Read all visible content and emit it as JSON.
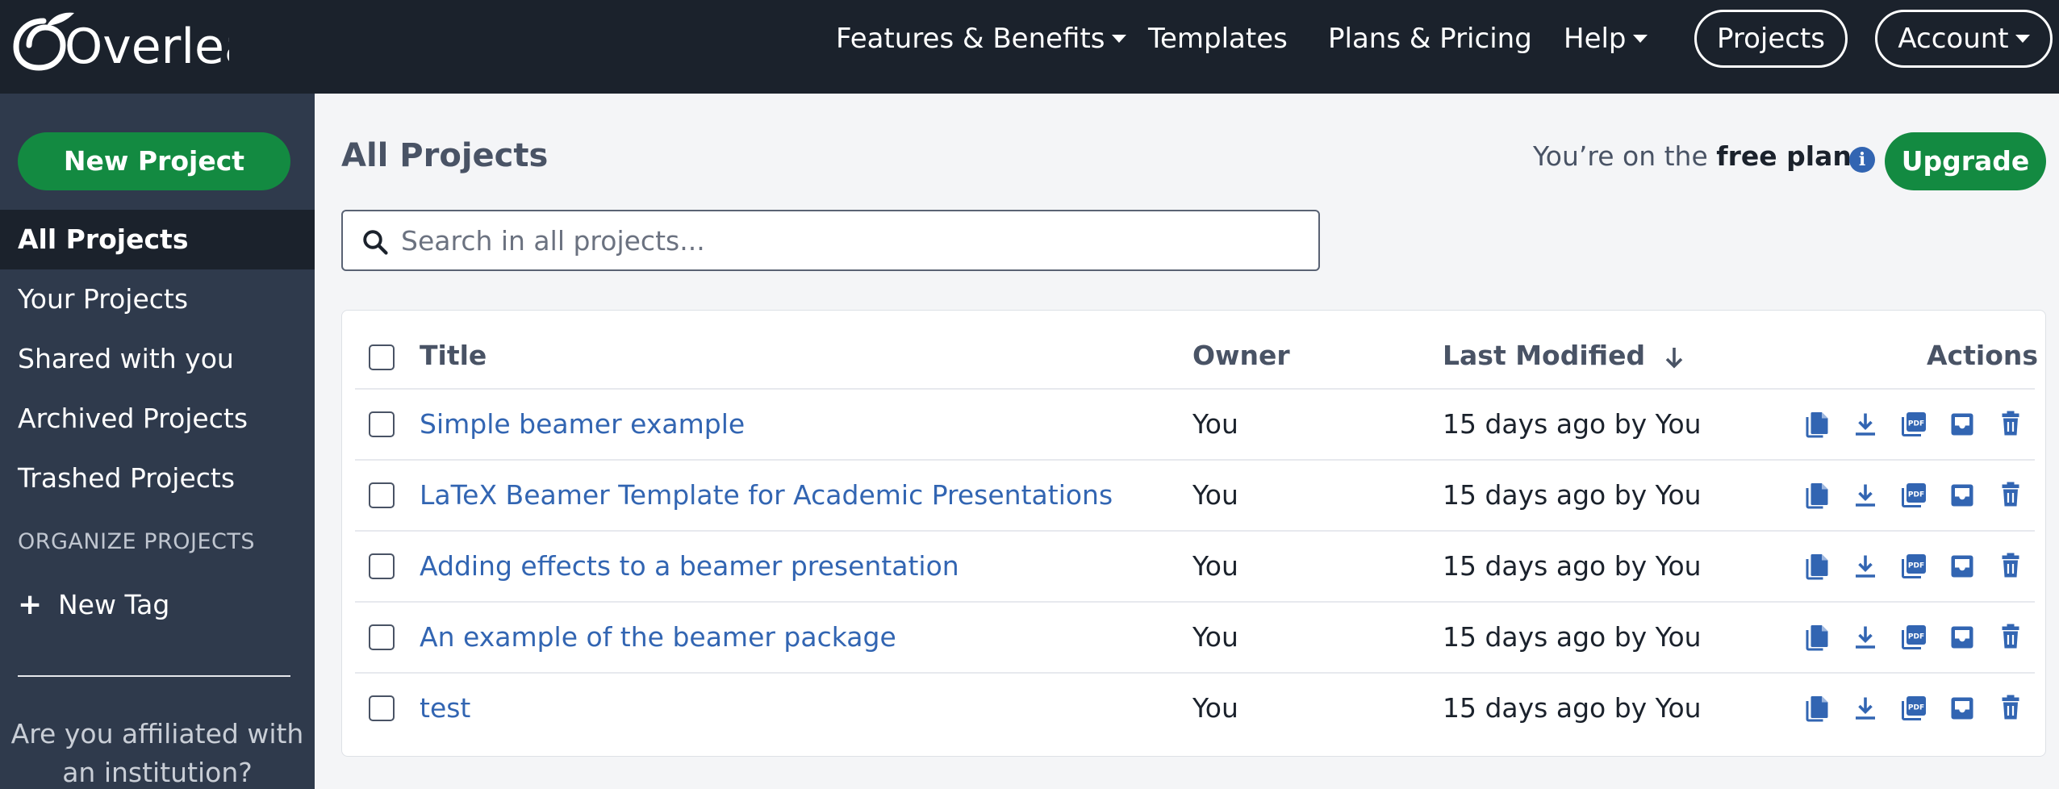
{
  "colors": {
    "nav_bg": "#1b222c",
    "sidebar_bg": "#2f3a4c",
    "primary_green": "#138a41",
    "link_blue": "#3265b2"
  },
  "nav": {
    "brand": "Overleaf",
    "features": "Features & Benefits",
    "templates": "Templates",
    "pricing": "Plans & Pricing",
    "help": "Help",
    "projects": "Projects",
    "account": "Account"
  },
  "sidebar": {
    "new_project": "New Project",
    "items": [
      "All Projects",
      "Your Projects",
      "Shared with you",
      "Archived Projects",
      "Trashed Projects"
    ],
    "organize_heading": "ORGANIZE PROJECTS",
    "new_tag": "New Tag",
    "affiliated_line1": "Are you affiliated with",
    "affiliated_line2": "an institution?"
  },
  "main": {
    "title": "All Projects",
    "plan_prefix": "You’re on the ",
    "plan_name": "free plan",
    "upgrade": "Upgrade",
    "search_placeholder": "Search in all projects..."
  },
  "table": {
    "headers": {
      "title": "Title",
      "owner": "Owner",
      "modified": "Last Modified",
      "actions": "Actions"
    },
    "rows": [
      {
        "title": "Simple beamer example",
        "owner": "You",
        "modified": "15 days ago by You"
      },
      {
        "title": "LaTeX Beamer Template for Academic Presentations",
        "owner": "You",
        "modified": "15 days ago by You"
      },
      {
        "title": "Adding effects to a beamer presentation",
        "owner": "You",
        "modified": "15 days ago by You"
      },
      {
        "title": "An example of the beamer package",
        "owner": "You",
        "modified": "15 days ago by You"
      },
      {
        "title": "test",
        "owner": "You",
        "modified": "15 days ago by You"
      }
    ],
    "action_icons": [
      "copy-icon",
      "download-icon",
      "pdf-download-icon",
      "archive-icon",
      "trash-icon"
    ]
  }
}
